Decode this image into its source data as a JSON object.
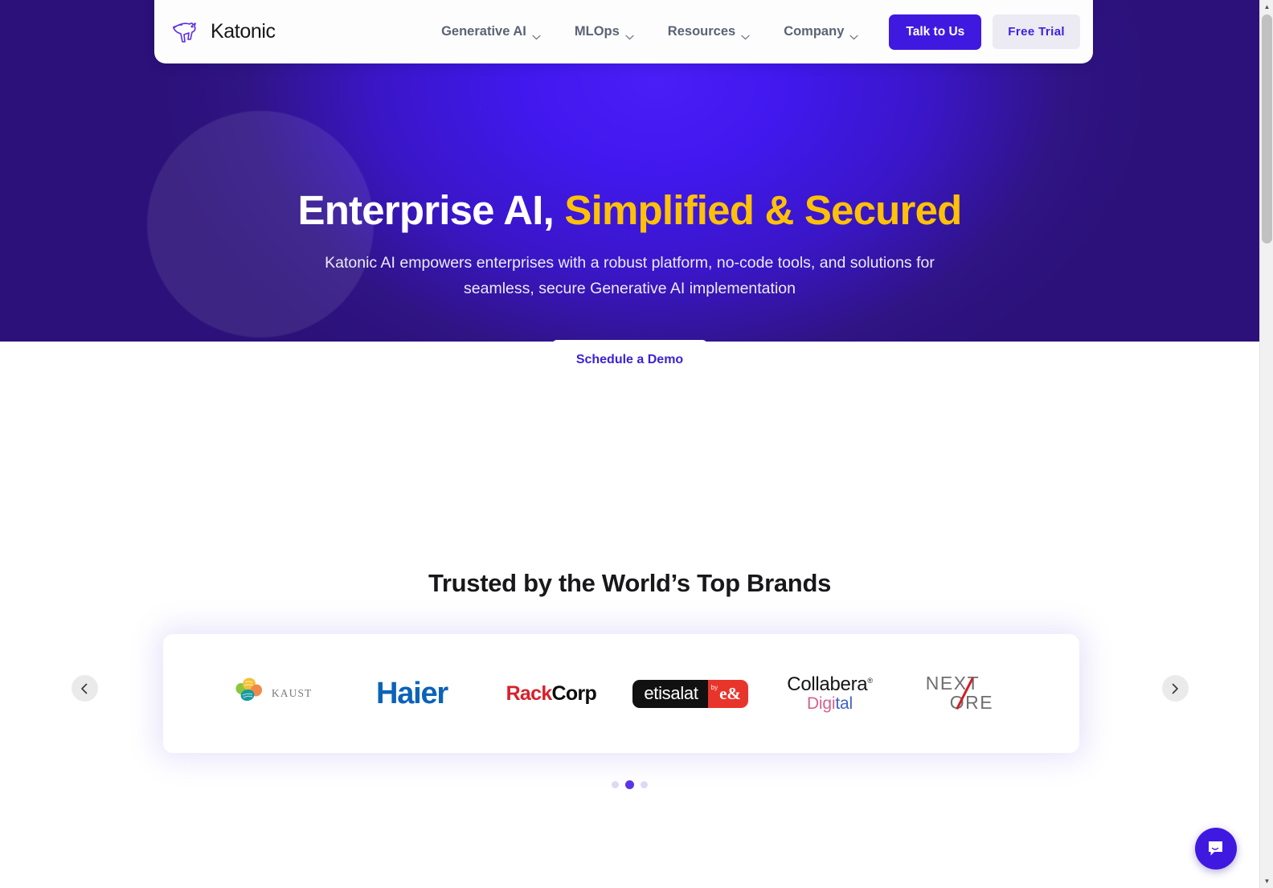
{
  "header": {
    "logo_word": "Katonic",
    "logo_icon": "kangaroo-logo-icon",
    "nav_items": [
      {
        "label": "Generative AI",
        "has_dropdown": true
      },
      {
        "label": "MLOps",
        "has_dropdown": true
      },
      {
        "label": "Resources",
        "has_dropdown": true
      },
      {
        "label": "Company",
        "has_dropdown": true
      }
    ],
    "talk_label": "Talk to Us",
    "trial_label": "Free Trial"
  },
  "hero": {
    "title_plain": "Enterprise AI, ",
    "title_accent": "Simplified & Secured",
    "subtitle": "Katonic AI empowers enterprises with a robust platform, no-code tools, and solutions for seamless, secure Generative AI implementation",
    "cta_label": "Schedule a Demo",
    "bg_center_color": "#4318f0",
    "bg_edge_color": "#2f1484",
    "accent_color": "#ffc107"
  },
  "brands": {
    "title": "Trusted by the World’s Top Brands",
    "logos": [
      {
        "name": "KAUST",
        "word": "KAUST"
      },
      {
        "name": "Haier",
        "word": "Haier"
      },
      {
        "name": "RackCorp",
        "word_a": "Rack",
        "word_b": "Corp"
      },
      {
        "name": "etisalat by e&",
        "word": "etisalat",
        "by": "by",
        "mark": "e&"
      },
      {
        "name": "Collabera Digital",
        "word_a": "Collabera",
        "word_b1": "Digi",
        "word_b2": "tal"
      },
      {
        "name": "NEXTORE",
        "word_a": "NEXT",
        "word_b": "ORE"
      }
    ],
    "prev_icon": "chevron-left-icon",
    "next_icon": "chevron-right-icon",
    "dots": [
      {
        "active": false
      },
      {
        "active": true
      },
      {
        "active": false
      }
    ]
  },
  "chat": {
    "icon": "chat-bubble-icon",
    "color": "#4019e0"
  },
  "scrollbar": {
    "up_arrow": "▲",
    "down_arrow": "▼"
  }
}
